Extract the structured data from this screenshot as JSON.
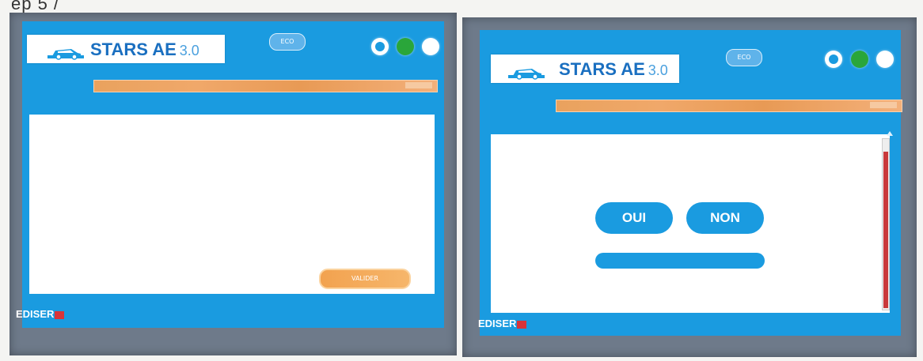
{
  "page": {
    "top_text": "ep 5 /"
  },
  "app": {
    "title": "STARS AE",
    "version": "3.0",
    "pill_label": "ECO",
    "brand": "EDISER"
  },
  "left_screen": {
    "validate_label": "VALIDER"
  },
  "right_screen": {
    "answers": {
      "yes": "OUI",
      "no": "NON"
    }
  },
  "colors": {
    "screen_blue": "#1a9be0",
    "progress_orange": "#f0a86a",
    "status_green": "#2aa63a",
    "scroll_red": "#c9393b",
    "frame_gray": "#6e7a8a"
  },
  "icons": [
    "car-icon",
    "logo-icon",
    "status-green-icon",
    "settings-icon",
    "scroll-up-icon"
  ]
}
